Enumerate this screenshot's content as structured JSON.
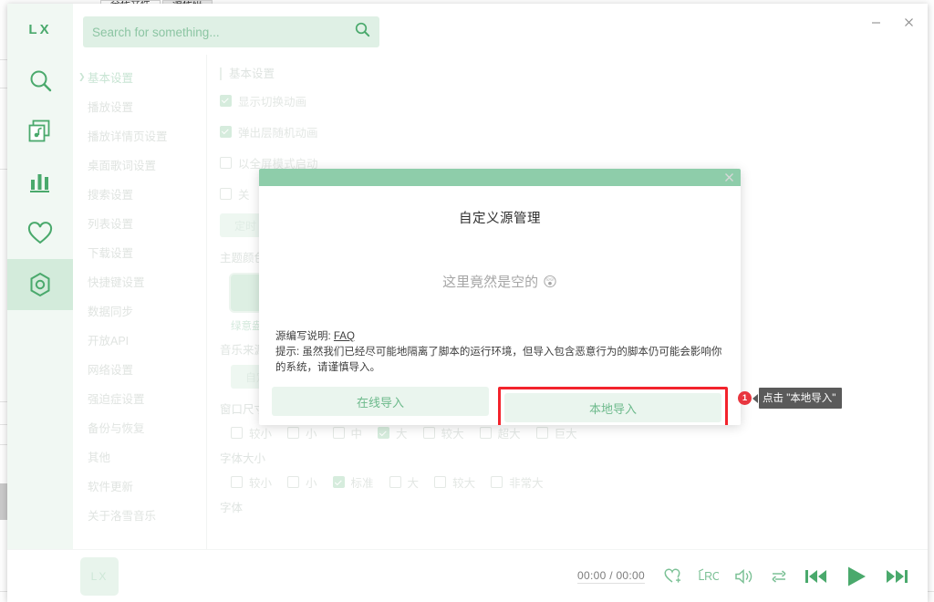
{
  "background_window": {
    "tabs": [
      {
        "label": "全代文件",
        "active": true
      },
      {
        "label": "源代码",
        "active": false
      }
    ]
  },
  "app": {
    "brand": "LX",
    "window_controls": [
      {
        "name": "minimize",
        "glyph": "minimize-icon"
      },
      {
        "name": "close",
        "glyph": "close-icon"
      }
    ],
    "sidebar_icons": [
      {
        "name": "search-icon",
        "active": false
      },
      {
        "name": "music-album-icon",
        "active": false
      },
      {
        "name": "chart-ranking-icon",
        "active": false
      },
      {
        "name": "heart-favorites-icon",
        "active": false
      },
      {
        "name": "settings-gear-icon",
        "active": true
      }
    ]
  },
  "search": {
    "placeholder": "Search for something...",
    "value": "",
    "icon": "search-icon"
  },
  "settings_nav": {
    "items": [
      {
        "label": "基本设置",
        "selected": true
      },
      {
        "label": "播放设置",
        "selected": false
      },
      {
        "label": "播放详情页设置",
        "selected": false
      },
      {
        "label": "桌面歌词设置",
        "selected": false
      },
      {
        "label": "搜索设置",
        "selected": false
      },
      {
        "label": "列表设置",
        "selected": false
      },
      {
        "label": "下载设置",
        "selected": false
      },
      {
        "label": "快捷键设置",
        "selected": false
      },
      {
        "label": "数据同步",
        "selected": false
      },
      {
        "label": "开放API",
        "selected": false
      },
      {
        "label": "网络设置",
        "selected": false
      },
      {
        "label": "强迫症设置",
        "selected": false
      },
      {
        "label": "备份与恢复",
        "selected": false
      },
      {
        "label": "其他",
        "selected": false
      },
      {
        "label": "软件更新",
        "selected": false
      },
      {
        "label": "关于洛雪音乐",
        "selected": false
      }
    ]
  },
  "settings_panel": {
    "section_title": "基本设置",
    "checkboxes": [
      {
        "label": "显示切换动画",
        "checked": true
      },
      {
        "label": "弹出层随机动画",
        "checked": true
      },
      {
        "label": "以全屏模式启动",
        "checked": false
      },
      {
        "label": "关",
        "checked": false
      }
    ],
    "timer_button": "定时",
    "theme_color_label": "主题颜色",
    "theme_swatch_caption": "绿意盎",
    "theme_swatch_color": "#ddefe3",
    "music_source_label": "音乐来源",
    "music_source_button": "自定",
    "window_size_label": "窗口尺寸",
    "window_size_options": [
      {
        "label": "较小",
        "checked": false
      },
      {
        "label": "小",
        "checked": false
      },
      {
        "label": "中",
        "checked": false
      },
      {
        "label": "大",
        "checked": true
      },
      {
        "label": "较大",
        "checked": false
      },
      {
        "label": "超大",
        "checked": false
      },
      {
        "label": "巨大",
        "checked": false
      }
    ],
    "font_size_label": "字体大小",
    "font_size_options": [
      {
        "label": "较小",
        "checked": false
      },
      {
        "label": "小",
        "checked": false
      },
      {
        "label": "标准",
        "checked": true
      },
      {
        "label": "大",
        "checked": false
      },
      {
        "label": "较大",
        "checked": false
      },
      {
        "label": "非常大",
        "checked": false
      }
    ],
    "font_label": "字体"
  },
  "dialog": {
    "header_color": "#8ecdaa",
    "close_icon": "close-icon",
    "title": "自定义源管理",
    "empty_text": "这里竟然是空的",
    "empty_emoji": "😲",
    "note_prefix": "源编写说明: ",
    "note_link": "FAQ",
    "warning": "提示: 虽然我们已经尽可能地隔离了脚本的运行环境，但导入包含恶意行为的脚本仍可能会影响你的系统，请谨慎导入。",
    "online_import_button": "在线导入",
    "local_import_button": "本地导入",
    "highlight_color": "#f3232c"
  },
  "callout": {
    "badge": "1",
    "text": "点击 \"本地导入\"",
    "badge_color": "#e8363f",
    "bubble_color": "#5a5a5a"
  },
  "player": {
    "album_placeholder": "LX",
    "time_display": "00:00 / 00:00",
    "controls": [
      {
        "name": "add-to-favorites-icon"
      },
      {
        "name": "lyrics-lrc-icon"
      },
      {
        "name": "volume-icon"
      },
      {
        "name": "repeat-mode-icon"
      },
      {
        "name": "previous-track-button"
      },
      {
        "name": "play-button"
      },
      {
        "name": "next-track-button"
      }
    ],
    "accent_color": "#4aa96c"
  }
}
